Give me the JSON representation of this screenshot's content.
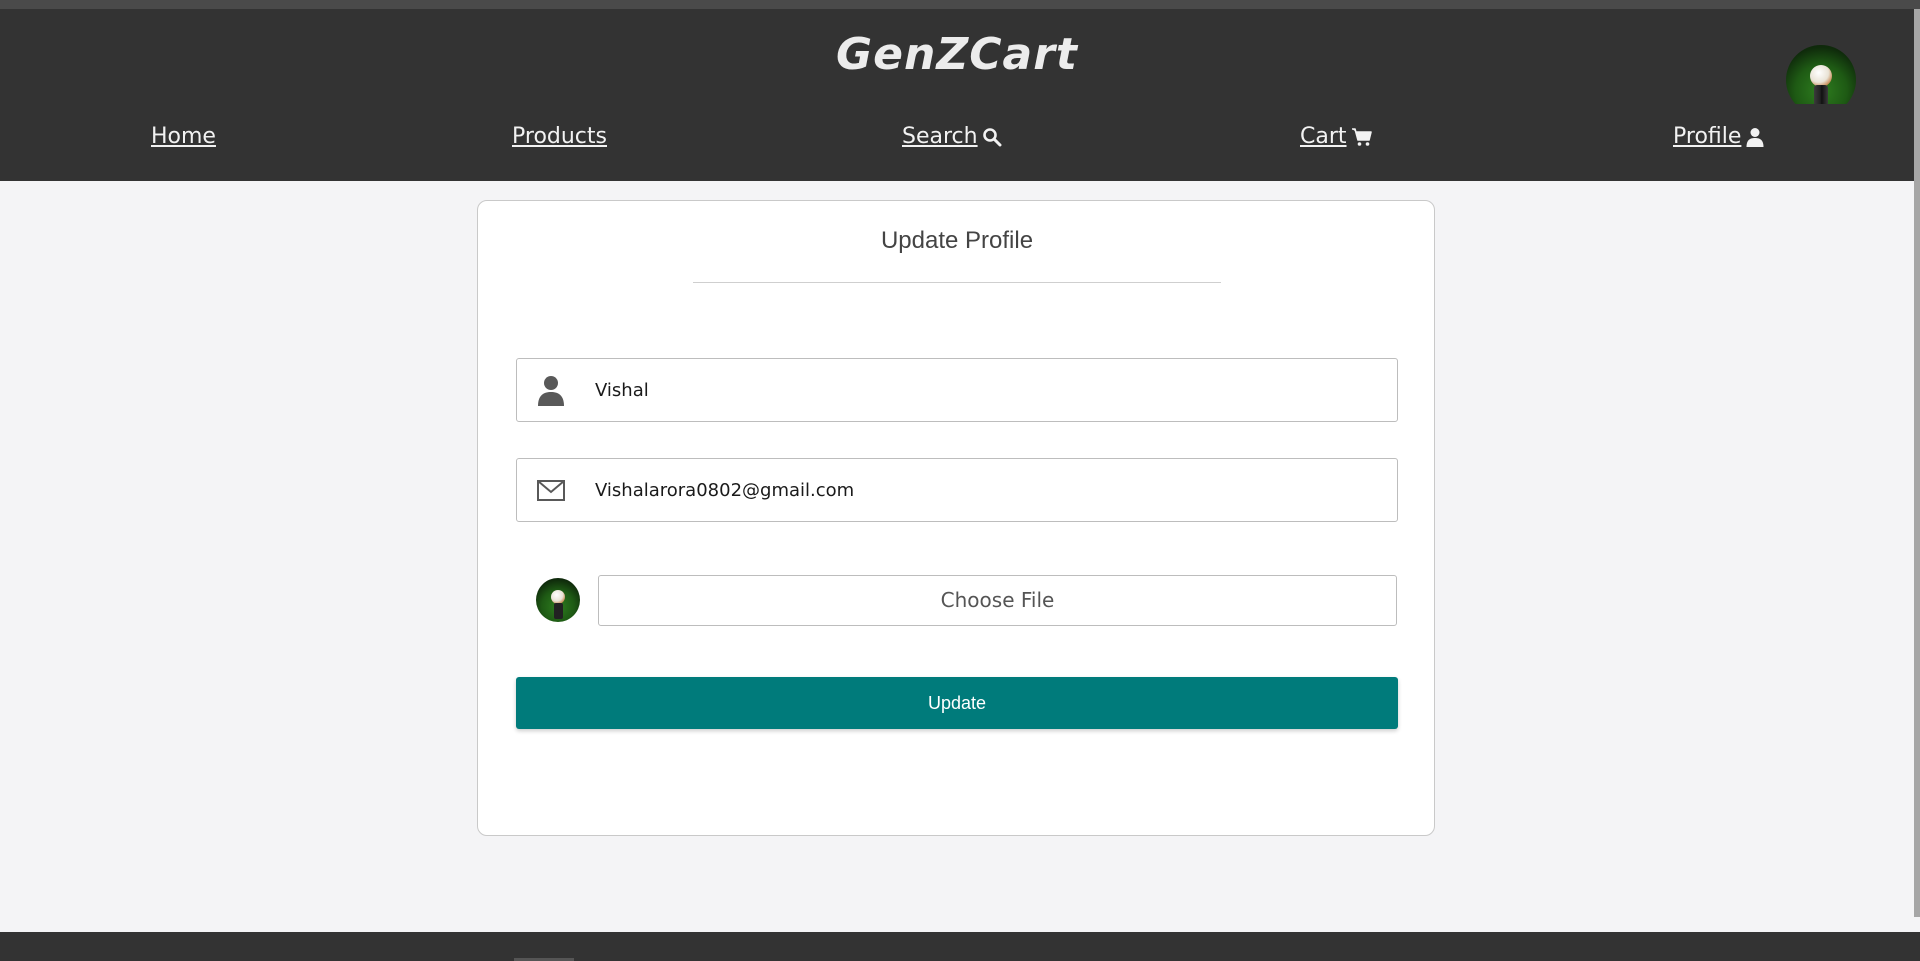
{
  "brand": {
    "title": "GenZCart"
  },
  "nav": {
    "items": [
      {
        "label": "Home",
        "icon": ""
      },
      {
        "label": "Products",
        "icon": ""
      },
      {
        "label": "Search ",
        "icon": "search-icon"
      },
      {
        "label": "Cart ",
        "icon": "cart-icon"
      },
      {
        "label": "Profile ",
        "icon": "user-icon"
      }
    ]
  },
  "form": {
    "title": "Update Profile",
    "name_value": "Vishal",
    "email_value": "Vishalarora0802@gmail.com",
    "file_button_label": "Choose File",
    "submit_label": "Update"
  },
  "colors": {
    "header_bg": "#333333",
    "accent": "#007b7b",
    "page_bg": "#f4f4f6"
  }
}
